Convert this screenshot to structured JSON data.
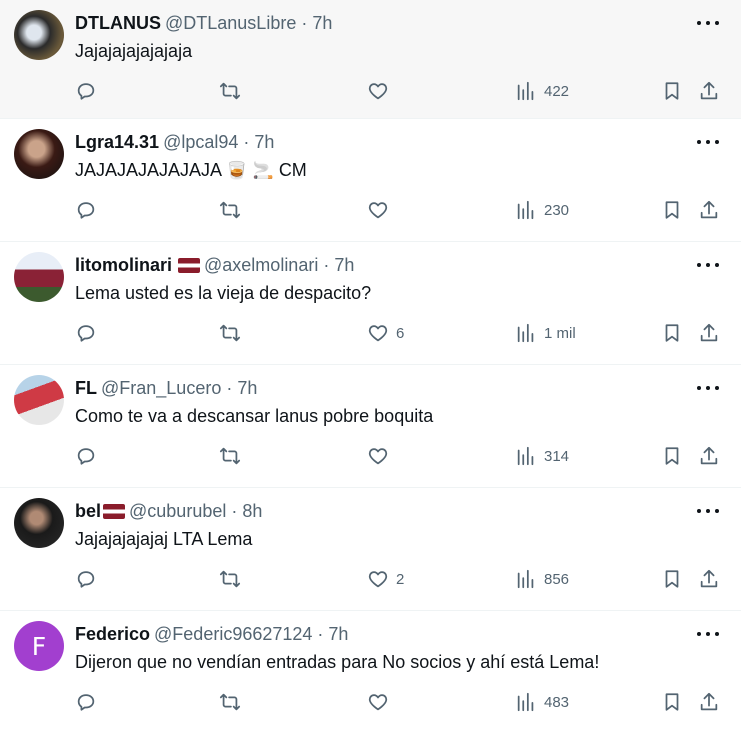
{
  "tweets": [
    {
      "avatar_letter": "",
      "name": "DTLANUS",
      "has_flag": false,
      "handle": "@DTLanusLibre",
      "time": "7h",
      "text": "Jajajajajajajaja",
      "emoji": "",
      "text_suffix": "",
      "likes": "",
      "views": "422"
    },
    {
      "avatar_letter": "",
      "name": "Lgra14.31",
      "has_flag": false,
      "handle": "@lpcal94",
      "time": "7h",
      "text": "JAJAJAJAJAJAJA",
      "emoji": "🥃 🚬",
      "text_suffix": "CM",
      "likes": "",
      "views": "230"
    },
    {
      "avatar_letter": "",
      "name": "litomolinari",
      "has_flag": true,
      "handle": "@axelmolinari",
      "time": "7h",
      "text": "Lema usted es la vieja de despacito?",
      "emoji": "",
      "text_suffix": "",
      "likes": "6",
      "views": "1 mil"
    },
    {
      "avatar_letter": "",
      "name": "FL",
      "has_flag": false,
      "handle": "@Fran_Lucero",
      "time": "7h",
      "text": "Como te va a descansar lanus pobre boquita",
      "emoji": "",
      "text_suffix": "",
      "likes": "",
      "views": "314"
    },
    {
      "avatar_letter": "",
      "name": "bel",
      "has_flag": true,
      "handle": "@cuburubel",
      "time": "8h",
      "text": "Jajajajajajaj LTA Lema",
      "emoji": "",
      "text_suffix": "",
      "likes": "2",
      "views": "856"
    },
    {
      "avatar_letter": "F",
      "name": "Federico",
      "has_flag": false,
      "handle": "@Federic96627124",
      "time": "7h",
      "text": "Dijeron que no vendían entradas para No socios y ahí está Lema!",
      "emoji": "",
      "text_suffix": "",
      "likes": "",
      "views": "483"
    }
  ],
  "separator": "·",
  "icons": {
    "reply": "reply-icon",
    "retweet": "retweet-icon",
    "like": "heart-icon",
    "views": "views-chart-icon",
    "bookmark": "bookmark-icon",
    "share": "share-icon",
    "more": "more-icon"
  },
  "colors": {
    "text": "#0f1419",
    "secondary": "#536471",
    "border": "#eff3f4",
    "avatar_f": "#a23fcf",
    "hover_bg": "#f7f7f7"
  }
}
